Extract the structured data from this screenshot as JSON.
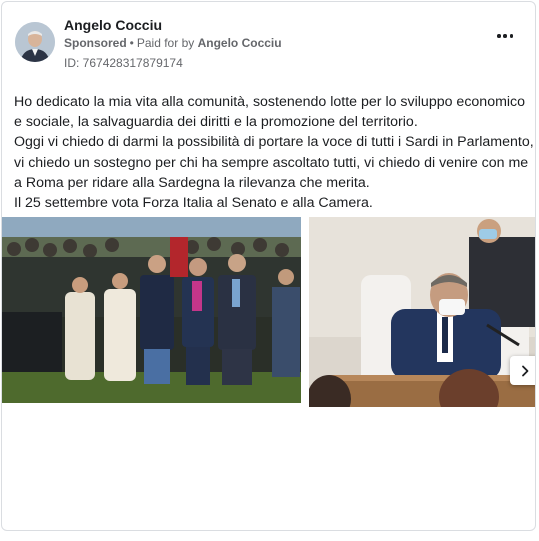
{
  "post": {
    "author": "Angelo Cocciu",
    "sponsored_label": "Sponsored",
    "paid_for_prefix": "Paid for by",
    "paid_for_name": "Angelo Cocciu",
    "ad_id": "ID: 767428317879174",
    "text_lines": [
      "Ho dedicato la mia vita alla comunità, sostenendo lotte per lo sviluppo economico",
      "e sociale, la salvaguardia dei diritti e la promozione del territorio.",
      "Oggi vi chiedo di darmi la possibilità di portare la voce di tutti i Sardi in Parlamento,",
      "vi chiedo un sostegno per chi ha sempre ascoltato tutti, vi chiedo di venire con me",
      "a Roma per ridare alla Sardegna la rilevanza che merita.",
      "Il 25 settembre vota Forza Italia al Senato e alla Camera."
    ]
  },
  "icons": {
    "more": "more-horizontal-icon",
    "next": "chevron-right-icon"
  },
  "colors": {
    "text": "#1c1e21",
    "secondary": "#65676b",
    "border": "#dadde1"
  }
}
